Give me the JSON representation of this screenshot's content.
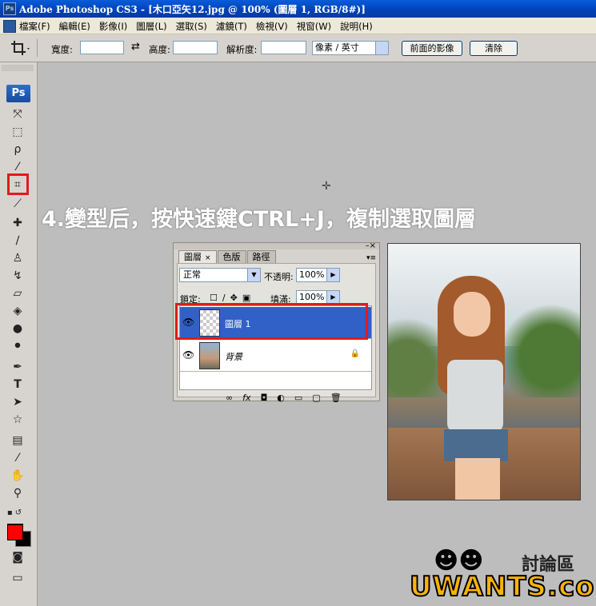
{
  "window": {
    "app_icon": "Ps",
    "title": "Adobe Photoshop CS3 - [木口亞矢12.jpg @ 100% (圖層 1, RGB/8#)]"
  },
  "menu": [
    "檔案(F)",
    "編輯(E)",
    "影像(I)",
    "圖層(L)",
    "選取(S)",
    "濾鏡(T)",
    "檢視(V)",
    "視窗(W)",
    "說明(H)"
  ],
  "options": {
    "width_label": "寬度:",
    "height_label": "高度:",
    "resolution_label": "解析度:",
    "unit_select": "像素 / 英寸",
    "front_image_button": "前面的影像",
    "clear_button": "清除"
  },
  "toolbox": {
    "logo": "Ps",
    "foreground_color": "#ff0000",
    "background_color": "#000000",
    "highlight_color": "#e21a1a"
  },
  "instruction": "4.變型后，按快速鍵CTRL+J，複制選取圖層",
  "layers_panel": {
    "tabs": [
      "圖層",
      "色版",
      "路徑"
    ],
    "blend_mode": "正常",
    "opacity_label": "不透明:",
    "opacity_value": "100%",
    "lock_label": "鎖定:",
    "fill_label": "填滿:",
    "fill_value": "100%",
    "layers": [
      {
        "name": "圖層 1",
        "selected": true
      },
      {
        "name": "背景",
        "selected": false
      }
    ],
    "selected_color": "#3160c7"
  },
  "logo": {
    "board_text": "討論區",
    "brand": "UWANTS.com"
  }
}
